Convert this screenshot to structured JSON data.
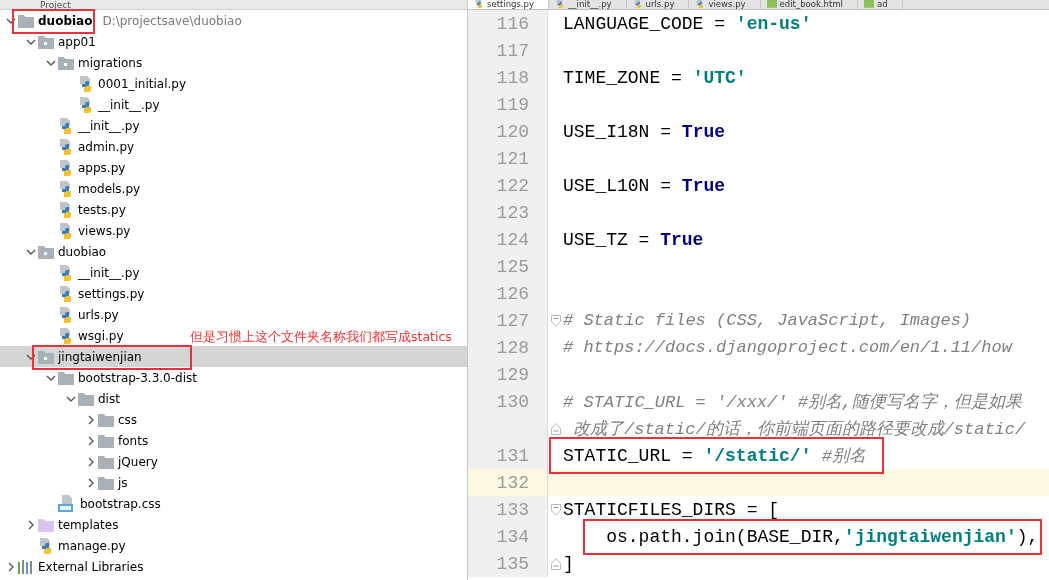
{
  "project": {
    "title": "Project",
    "tree": [
      {
        "label": "duobiao",
        "path": "D:\\projectsave\\duobiao",
        "kind": "folder",
        "expanded": true,
        "selected": false,
        "boxed": true,
        "children": [
          {
            "label": "app01",
            "kind": "package",
            "expanded": true,
            "selected": false,
            "boxed": false,
            "children": [
              {
                "label": "migrations",
                "kind": "package",
                "expanded": true,
                "selected": false,
                "boxed": false,
                "children": [
                  {
                    "label": "0001_initial.py",
                    "kind": "python",
                    "selected": false,
                    "boxed": false
                  },
                  {
                    "label": "__init__.py",
                    "kind": "python",
                    "selected": false,
                    "boxed": false
                  }
                ]
              },
              {
                "label": "__init__.py",
                "kind": "python",
                "selected": false,
                "boxed": false
              },
              {
                "label": "admin.py",
                "kind": "python",
                "selected": false,
                "boxed": false
              },
              {
                "label": "apps.py",
                "kind": "python",
                "selected": false,
                "boxed": false
              },
              {
                "label": "models.py",
                "kind": "python",
                "selected": false,
                "boxed": false
              },
              {
                "label": "tests.py",
                "kind": "python",
                "selected": false,
                "boxed": false
              },
              {
                "label": "views.py",
                "kind": "python",
                "selected": false,
                "boxed": false
              }
            ]
          },
          {
            "label": "duobiao",
            "kind": "package",
            "expanded": true,
            "selected": false,
            "boxed": false,
            "children": [
              {
                "label": "__init__.py",
                "kind": "python",
                "selected": false,
                "boxed": false
              },
              {
                "label": "settings.py",
                "kind": "python",
                "selected": false,
                "boxed": false
              },
              {
                "label": "urls.py",
                "kind": "python",
                "selected": false,
                "boxed": false
              },
              {
                "label": "wsgi.py",
                "kind": "python",
                "selected": false,
                "boxed": false
              }
            ]
          },
          {
            "label": "jingtaiwenjian",
            "kind": "package",
            "expanded": true,
            "selected": true,
            "boxed": true,
            "children": [
              {
                "label": "bootstrap-3.3.0-dist",
                "kind": "folder",
                "expanded": true,
                "selected": false,
                "boxed": false,
                "children": [
                  {
                    "label": "dist",
                    "kind": "folder",
                    "expanded": true,
                    "selected": false,
                    "boxed": false,
                    "children": [
                      {
                        "label": "css",
                        "kind": "folder",
                        "expanded": false,
                        "selected": false,
                        "boxed": false
                      },
                      {
                        "label": "fonts",
                        "kind": "folder",
                        "expanded": false,
                        "selected": false,
                        "boxed": false
                      },
                      {
                        "label": "jQuery",
                        "kind": "folder",
                        "expanded": false,
                        "selected": false,
                        "boxed": false
                      },
                      {
                        "label": "js",
                        "kind": "folder",
                        "expanded": false,
                        "selected": false,
                        "boxed": false
                      }
                    ]
                  }
                ]
              },
              {
                "label": "bootstrap.css",
                "kind": "css",
                "selected": false,
                "boxed": false
              }
            ]
          },
          {
            "label": "templates",
            "kind": "templates",
            "expanded": false,
            "selected": false,
            "boxed": false
          },
          {
            "label": "manage.py",
            "kind": "python",
            "selected": false,
            "boxed": false
          }
        ]
      },
      {
        "label": "External Libraries",
        "kind": "libraries",
        "expanded": false,
        "selected": false,
        "boxed": false
      }
    ]
  },
  "tabs": [
    {
      "label": "settings.py",
      "kind": "python",
      "selected": true
    },
    {
      "label": "__init__.py",
      "kind": "python",
      "selected": false
    },
    {
      "label": "urls.py",
      "kind": "python",
      "selected": false
    },
    {
      "label": "views.py",
      "kind": "python",
      "selected": false
    },
    {
      "label": "edit_book.html",
      "kind": "html",
      "selected": false
    },
    {
      "label": "ad",
      "kind": "html",
      "selected": false
    }
  ],
  "editor": {
    "lines": [
      {
        "number": "116",
        "current": false,
        "boxed": false,
        "fold_open": false,
        "fold_close": false,
        "tokens": [
          {
            "text": "LANGUAGE_CODE = ",
            "kind": "plain"
          },
          {
            "text": "'en-us'",
            "kind": "string"
          }
        ]
      },
      {
        "number": "117",
        "current": false,
        "boxed": false,
        "fold_open": false,
        "fold_close": false
      },
      {
        "number": "118",
        "current": false,
        "boxed": false,
        "fold_open": false,
        "fold_close": false,
        "tokens": [
          {
            "text": "TIME_ZONE = ",
            "kind": "plain"
          },
          {
            "text": "'UTC'",
            "kind": "string"
          }
        ]
      },
      {
        "number": "119",
        "current": false,
        "boxed": false,
        "fold_open": false,
        "fold_close": false
      },
      {
        "number": "120",
        "current": false,
        "boxed": false,
        "fold_open": false,
        "fold_close": false,
        "tokens": [
          {
            "text": "USE_I18N = ",
            "kind": "plain"
          },
          {
            "text": "True",
            "kind": "keyword"
          }
        ]
      },
      {
        "number": "121",
        "current": false,
        "boxed": false,
        "fold_open": false,
        "fold_close": false
      },
      {
        "number": "122",
        "current": false,
        "boxed": false,
        "fold_open": false,
        "fold_close": false,
        "tokens": [
          {
            "text": "USE_L10N = ",
            "kind": "plain"
          },
          {
            "text": "True",
            "kind": "keyword"
          }
        ]
      },
      {
        "number": "123",
        "current": false,
        "boxed": false,
        "fold_open": false,
        "fold_close": false
      },
      {
        "number": "124",
        "current": false,
        "boxed": false,
        "fold_open": false,
        "fold_close": false,
        "tokens": [
          {
            "text": "USE_TZ = ",
            "kind": "plain"
          },
          {
            "text": "True",
            "kind": "keyword"
          }
        ]
      },
      {
        "number": "125",
        "current": false,
        "boxed": false,
        "fold_open": false,
        "fold_close": false
      },
      {
        "number": "126",
        "current": false,
        "boxed": false,
        "fold_open": false,
        "fold_close": false
      },
      {
        "number": "127",
        "current": false,
        "boxed": false,
        "fold_open": true,
        "fold_close": false,
        "tokens": [
          {
            "text": "# Static files (CSS, JavaScript, Images)",
            "kind": "comment"
          }
        ]
      },
      {
        "number": "128",
        "current": false,
        "boxed": false,
        "fold_open": false,
        "fold_close": false,
        "tokens": [
          {
            "text": "# https://docs.djangoproject.com/en/1.11/how",
            "kind": "comment"
          }
        ]
      },
      {
        "number": "129",
        "current": false,
        "boxed": false,
        "fold_open": false,
        "fold_close": false
      },
      {
        "number": "130",
        "current": false,
        "boxed": false,
        "fold_open": false,
        "fold_close": true,
        "tokens": [
          {
            "text": "# STATIC_URL = '/xxx/' #别名,随便写名字，但是如果",
            "kind": "comment"
          }
        ],
        "wrapped_tokens": [
          {
            "text": "改成了/static/的话，你前端页面的路径要改成/static/",
            "kind": "comment"
          }
        ]
      },
      {
        "number": "131",
        "current": false,
        "boxed": true,
        "fold_open": false,
        "fold_close": false,
        "tokens": [
          {
            "text": "STATIC_URL = ",
            "kind": "plain"
          },
          {
            "text": "'/static/'",
            "kind": "string"
          },
          {
            "text": " #别名",
            "kind": "comment"
          }
        ]
      },
      {
        "number": "132",
        "current": true,
        "boxed": false,
        "fold_open": false,
        "fold_close": false
      },
      {
        "number": "133",
        "current": false,
        "boxed": false,
        "fold_open": true,
        "fold_close": false,
        "tokens": [
          {
            "text": "STATICFILES_DIRS = [",
            "kind": "plain"
          }
        ]
      },
      {
        "number": "134",
        "current": false,
        "boxed": true,
        "fold_open": false,
        "fold_close": false,
        "tokens": [
          {
            "text": "    os.path.join(BASE_DIR,",
            "kind": "plain"
          },
          {
            "text": "'jingtaiwenjian'",
            "kind": "string"
          },
          {
            "text": "),",
            "kind": "plain"
          }
        ]
      },
      {
        "number": "135",
        "current": false,
        "boxed": false,
        "fold_open": false,
        "fold_close": true,
        "tokens": [
          {
            "text": "]",
            "kind": "plain"
          }
        ]
      }
    ]
  },
  "note": "但是习惯上这个文件夹名称我们都写成statics"
}
